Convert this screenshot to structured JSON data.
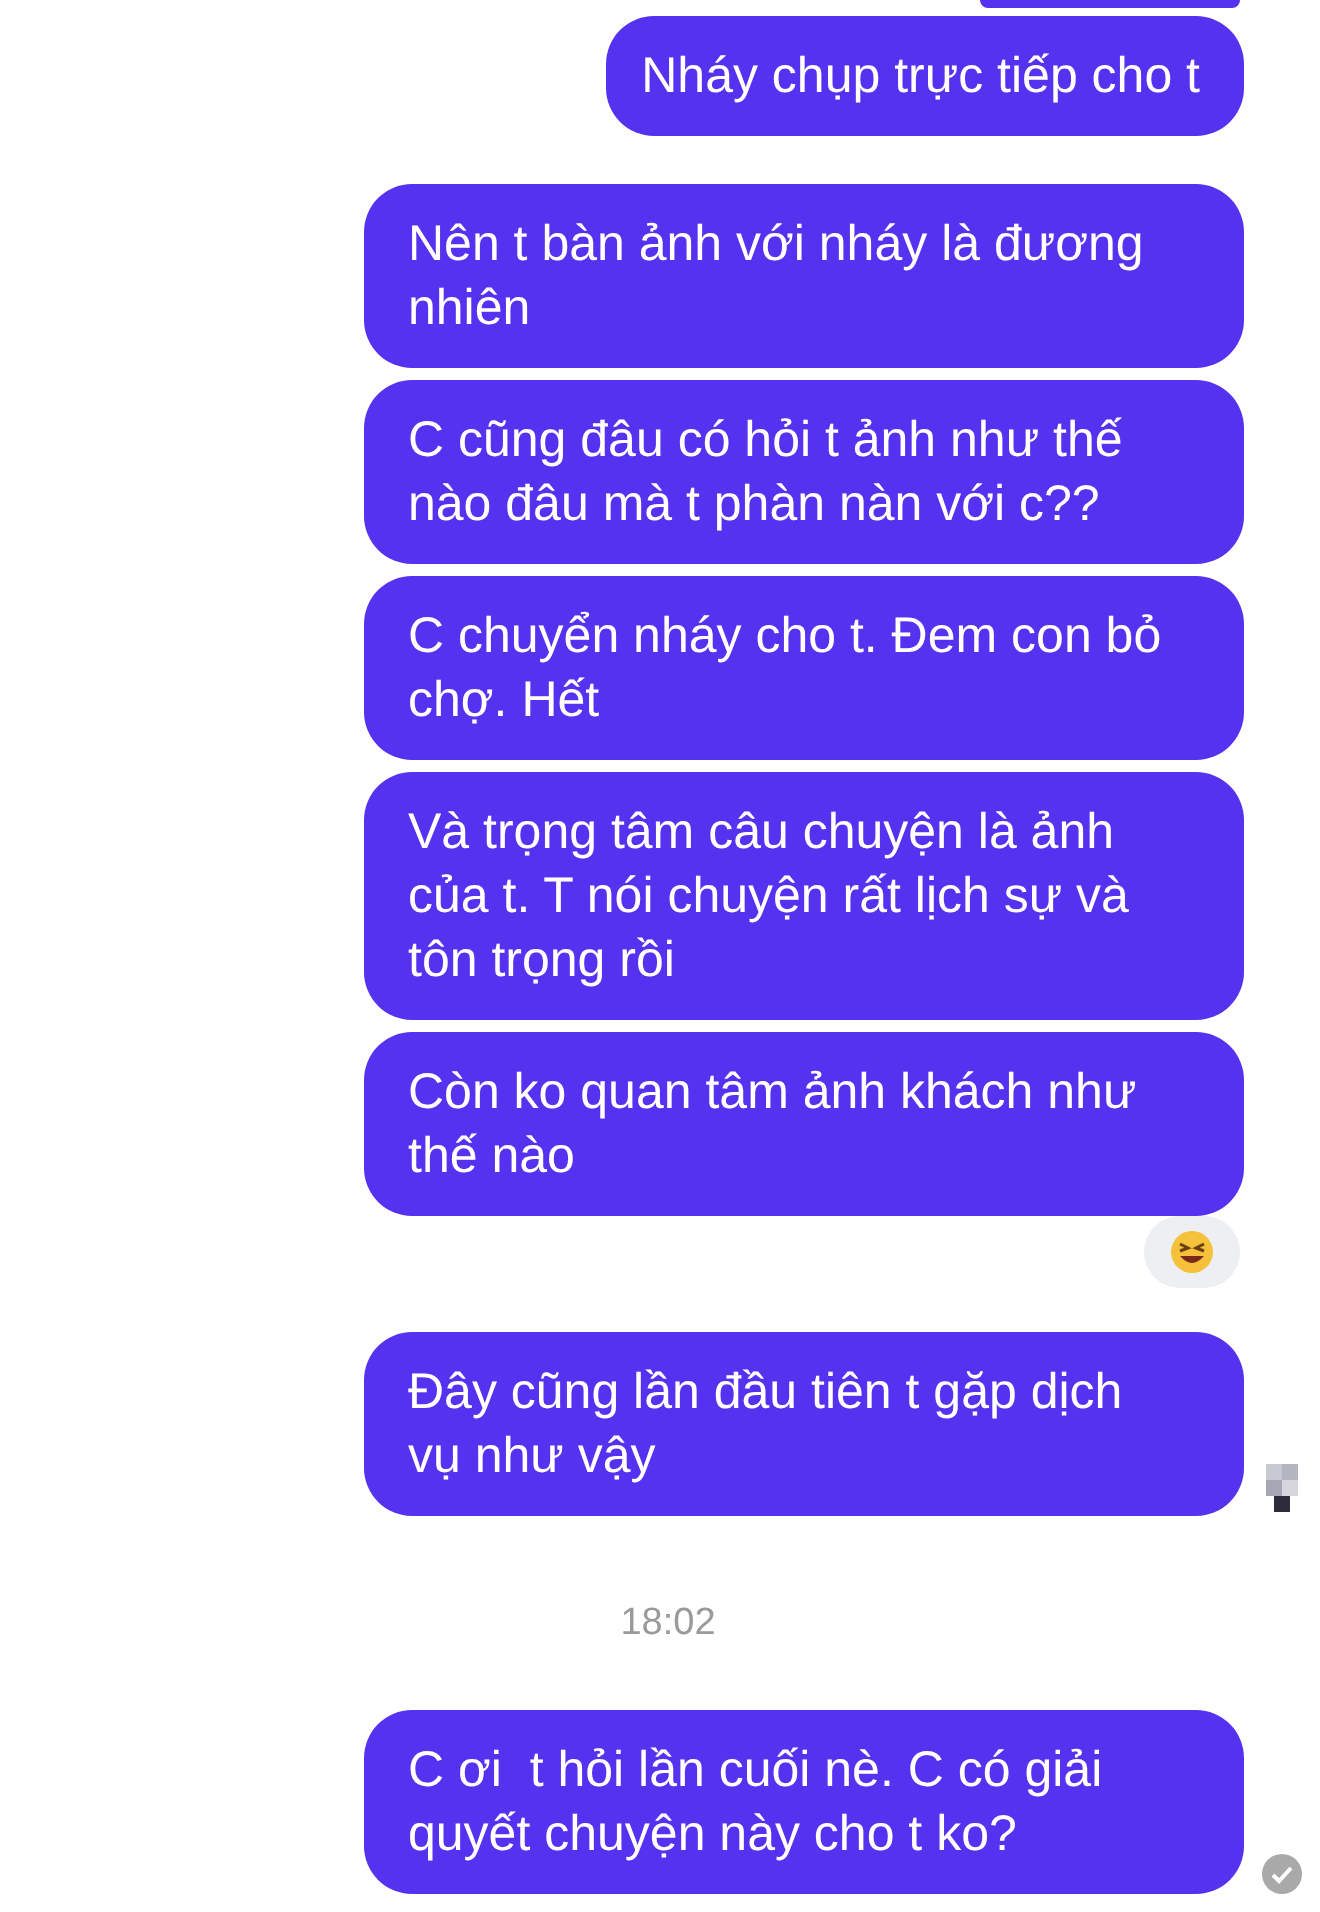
{
  "groups": [
    {
      "kind": "messages",
      "messages": [
        {
          "text": "Nháy chụp trực tiếp cho t",
          "reaction": false,
          "seen": false,
          "delivered": false
        }
      ]
    },
    {
      "kind": "messages",
      "messages": [
        {
          "text": "Nên t bàn ảnh với nháy là đương nhiên",
          "reaction": false,
          "seen": false,
          "delivered": false
        },
        {
          "text": "C cũng đâu có hỏi t ảnh như thế nào đâu mà t phàn nàn với c??",
          "reaction": false,
          "seen": false,
          "delivered": false
        },
        {
          "text": "C chuyển nháy cho t. Đem con bỏ chợ. Hết",
          "reaction": false,
          "seen": false,
          "delivered": false
        },
        {
          "text": "Và trọng tâm câu chuyện là ảnh của t. T nói chuyện rất lịch sự và tôn trọng rồi",
          "reaction": false,
          "seen": false,
          "delivered": false
        },
        {
          "text": "Còn ko quan tâm ảnh khách như thế nào",
          "reaction": true,
          "seen": false,
          "delivered": false
        }
      ]
    },
    {
      "kind": "messages",
      "messages": [
        {
          "text": "Đây cũng lần đầu tiên t gặp dịch vụ như vậy",
          "reaction": false,
          "seen": true,
          "delivered": false
        }
      ]
    },
    {
      "kind": "timestamp",
      "text": "18:02"
    },
    {
      "kind": "messages",
      "messages": [
        {
          "text": "C ơi  t hỏi lần cuối nè. C có giải quyết chuyện này cho t ko?",
          "reaction": false,
          "seen": false,
          "delivered": true
        }
      ]
    }
  ]
}
